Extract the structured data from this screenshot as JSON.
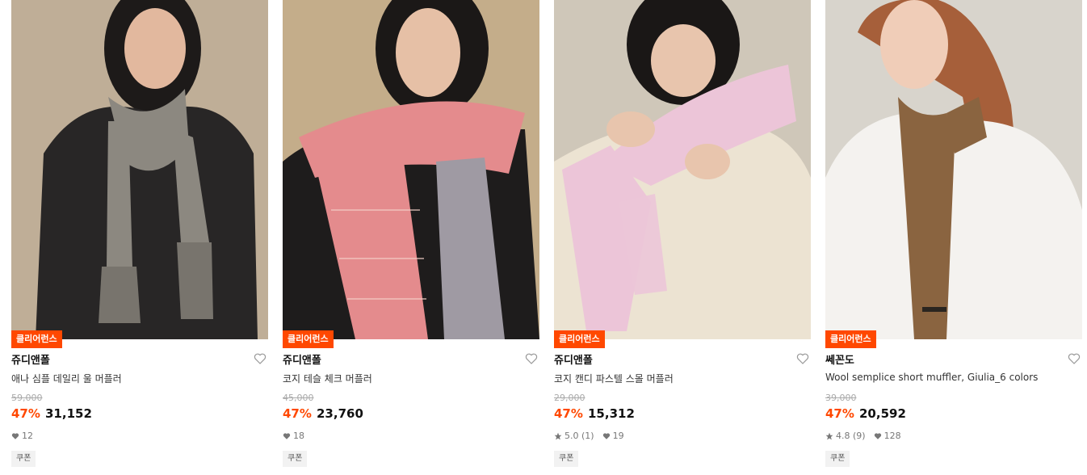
{
  "products": [
    {
      "badge": "클리어런스",
      "brand": "쥬디앤폴",
      "title": "애나 심플 데일리 울 머플러",
      "original_price": "59,000",
      "discount": "47%",
      "price": "31,152",
      "rating": "",
      "likes": "12",
      "coupon": "쿠폰",
      "scarf_color": "#8c8880"
    },
    {
      "badge": "클리어런스",
      "brand": "쥬디앤폴",
      "title": "코지 테슬 체크 머플러",
      "original_price": "45,000",
      "discount": "47%",
      "price": "23,760",
      "rating": "",
      "likes": "18",
      "coupon": "쿠폰",
      "scarf_color": "#e48b8d"
    },
    {
      "badge": "클리어런스",
      "brand": "쥬디앤폴",
      "title": "코지 캔디 파스텔 스몰 머플러",
      "original_price": "29,000",
      "discount": "47%",
      "price": "15,312",
      "rating": "5.0 (1)",
      "likes": "19",
      "coupon": "쿠폰",
      "scarf_color": "#ecc5d8"
    },
    {
      "badge": "클리어런스",
      "brand": "쎄꼰도",
      "title": "Wool semplice short muffler, Giulia_6 colors",
      "original_price": "39,000",
      "discount": "47%",
      "price": "20,592",
      "rating": "4.8 (9)",
      "likes": "128",
      "coupon": "쿠폰",
      "scarf_color": "#8a6440"
    }
  ],
  "colors": {
    "accent": "#ff4800",
    "heart_outline": "#999999",
    "meta_icon": "#777777"
  }
}
